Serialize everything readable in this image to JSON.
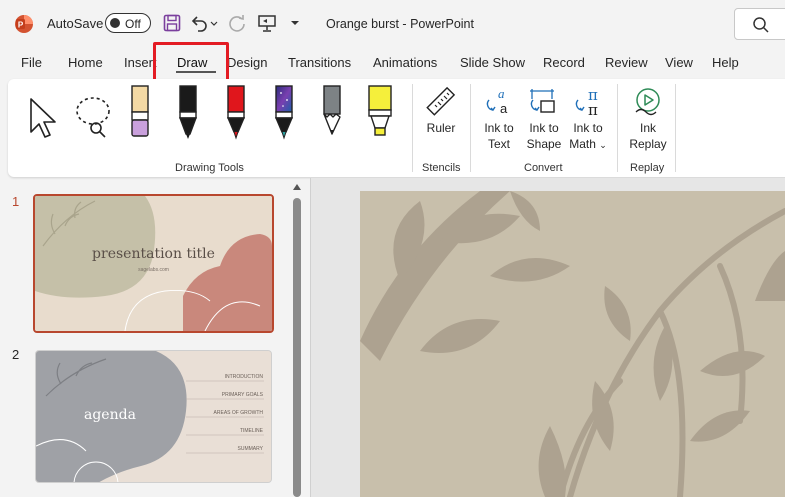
{
  "titlebar": {
    "autosave_label": "AutoSave",
    "autosave_state": "Off",
    "doc_title": "Orange burst  -  PowerPoint"
  },
  "tabs": [
    {
      "label": "File"
    },
    {
      "label": "Home"
    },
    {
      "label": "Insert"
    },
    {
      "label": "Draw"
    },
    {
      "label": "Design"
    },
    {
      "label": "Transitions"
    },
    {
      "label": "Animations"
    },
    {
      "label": "Slide Show"
    },
    {
      "label": "Record"
    },
    {
      "label": "Review"
    },
    {
      "label": "View"
    },
    {
      "label": "Help"
    }
  ],
  "active_tab": "Draw",
  "ribbon": {
    "groups": {
      "drawing_tools": "Drawing Tools",
      "stencils": "Stencils",
      "convert": "Convert",
      "replay": "Replay"
    },
    "buttons": {
      "ruler": "Ruler",
      "ink_to_text_1": "Ink to",
      "ink_to_text_2": "Text",
      "ink_to_shape_1": "Ink to",
      "ink_to_shape_2": "Shape",
      "ink_to_math_1": "Ink to",
      "ink_to_math_2": "Math",
      "ink_replay_1": "Ink",
      "ink_replay_2": "Replay"
    },
    "pens": [
      {
        "name": "pencil-light-purple",
        "color": "#c9a0dc"
      },
      {
        "name": "pen-black",
        "color": "#1a1a1a"
      },
      {
        "name": "pen-red",
        "color": "#e0161c"
      },
      {
        "name": "pen-galaxy-teal",
        "color": "#2aa3a3"
      },
      {
        "name": "pencil-gray",
        "color": "#7d8285"
      },
      {
        "name": "highlighter-yellow",
        "color": "#f5ef3b"
      }
    ]
  },
  "slides": [
    {
      "number": "1",
      "title": "presentation title",
      "subtitle": "sagelabs.com"
    },
    {
      "number": "2",
      "title": "agenda",
      "items": [
        "INTRODUCTION",
        "PRIMARY GOALS",
        "AREAS OF GROWTH",
        "TIMELINE",
        "SUMMARY"
      ]
    }
  ],
  "colors": {
    "accent_red": "#e31b23",
    "selected_slide_border": "#b8472e",
    "slide_bg": "#c8bfab"
  }
}
